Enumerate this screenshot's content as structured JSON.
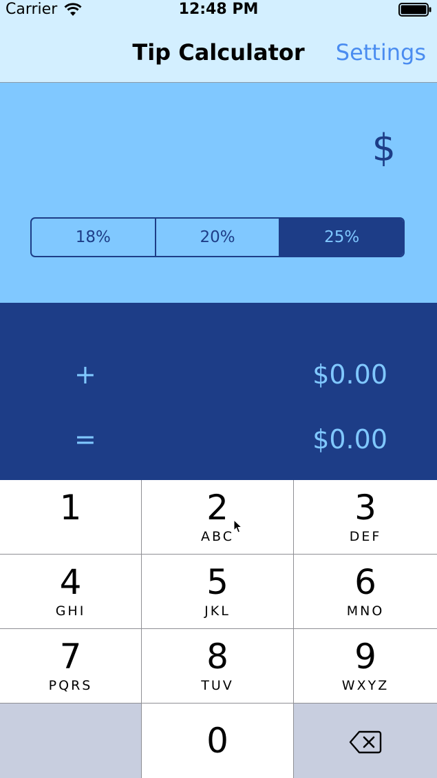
{
  "status_bar": {
    "carrier": "Carrier",
    "time": "12:48 PM"
  },
  "nav": {
    "title": "Tip Calculator",
    "settings_label": "Settings"
  },
  "bill_input": {
    "value": "",
    "placeholder": "$"
  },
  "tip_segments": {
    "options": [
      "18%",
      "20%",
      "25%"
    ],
    "selected_index": 2
  },
  "results": {
    "tip_symbol": "+",
    "tip_amount": "$0.00",
    "total_symbol": "=",
    "total_amount": "$0.00"
  },
  "keypad": {
    "keys": [
      {
        "digit": "1",
        "letters": ""
      },
      {
        "digit": "2",
        "letters": "ABC"
      },
      {
        "digit": "3",
        "letters": "DEF"
      },
      {
        "digit": "4",
        "letters": "GHI"
      },
      {
        "digit": "5",
        "letters": "JKL"
      },
      {
        "digit": "6",
        "letters": "MNO"
      },
      {
        "digit": "7",
        "letters": "PQRS"
      },
      {
        "digit": "8",
        "letters": "TUV"
      },
      {
        "digit": "9",
        "letters": "WXYZ"
      },
      {
        "digit": "0",
        "letters": ""
      }
    ]
  },
  "colors": {
    "nav_background": "#d3efff",
    "accent_light": "#80c8ff",
    "accent_dark": "#1d3d87",
    "settings_link": "#4a8cf0",
    "key_gray": "#c8cedf"
  },
  "icons": {
    "wifi": "wifi-icon",
    "battery": "battery-icon",
    "backspace": "backspace-icon",
    "cursor": "mouse-cursor-icon"
  }
}
